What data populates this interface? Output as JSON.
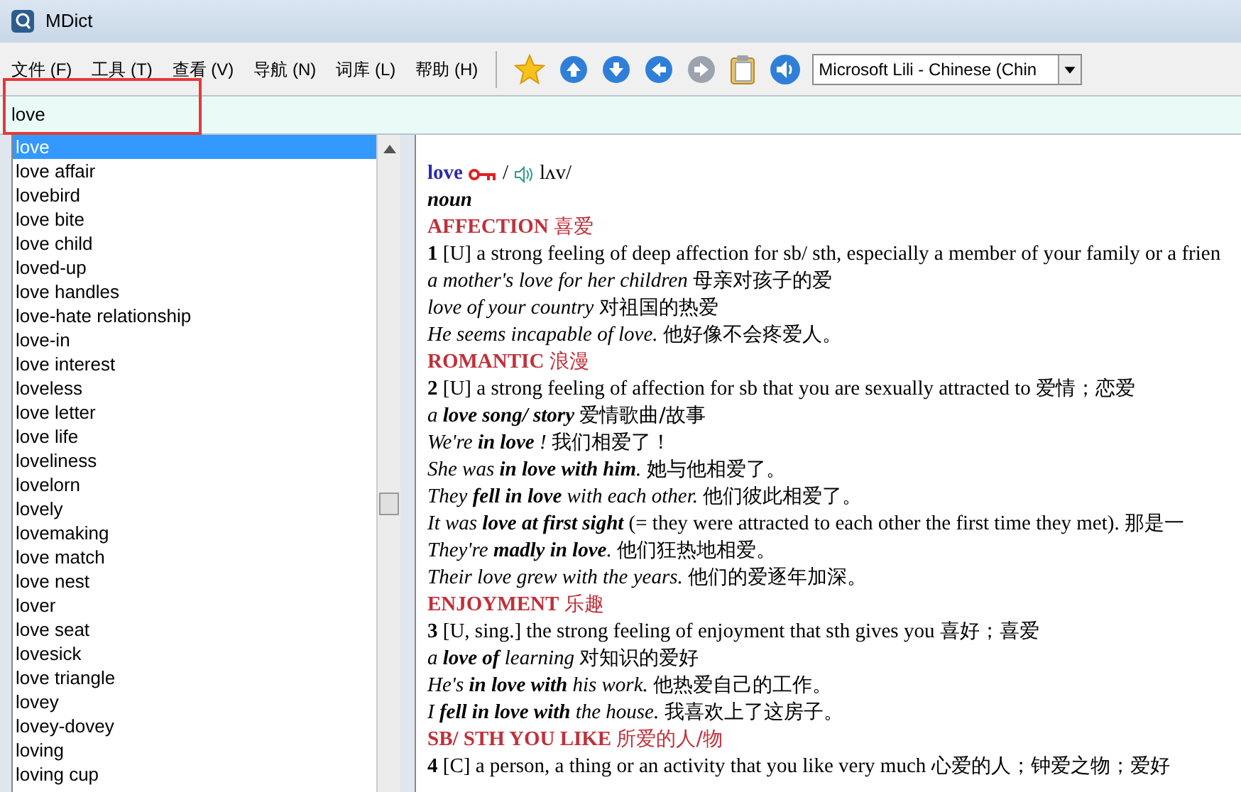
{
  "window": {
    "title": "MDict"
  },
  "menu": [
    {
      "label": "文件 (F)"
    },
    {
      "label": "工具 (T)"
    },
    {
      "label": "查看 (V)"
    },
    {
      "label": "导航 (N)"
    },
    {
      "label": "词库 (L)"
    },
    {
      "label": "帮助 (H)"
    }
  ],
  "toolbar": [
    {
      "kind": "star",
      "disabled": false
    },
    {
      "kind": "up",
      "disabled": false
    },
    {
      "kind": "down",
      "disabled": false
    },
    {
      "kind": "back",
      "disabled": false
    },
    {
      "kind": "forward",
      "disabled": true
    },
    {
      "kind": "clipboard",
      "disabled": false
    },
    {
      "kind": "speaker",
      "disabled": false
    }
  ],
  "voice_select": {
    "value": "Microsoft Lili - Chinese (Chin"
  },
  "search": {
    "value": "love"
  },
  "word_list": [
    {
      "label": "love",
      "selected": true
    },
    {
      "label": "love affair",
      "selected": false
    },
    {
      "label": "lovebird",
      "selected": false
    },
    {
      "label": "love bite",
      "selected": false
    },
    {
      "label": "love child",
      "selected": false
    },
    {
      "label": "loved-up",
      "selected": false
    },
    {
      "label": "love handles",
      "selected": false
    },
    {
      "label": "love-hate relationship",
      "selected": false
    },
    {
      "label": "love-in",
      "selected": false
    },
    {
      "label": "love interest",
      "selected": false
    },
    {
      "label": "loveless",
      "selected": false
    },
    {
      "label": "love letter",
      "selected": false
    },
    {
      "label": "love life",
      "selected": false
    },
    {
      "label": "loveliness",
      "selected": false
    },
    {
      "label": "lovelorn",
      "selected": false
    },
    {
      "label": "lovely",
      "selected": false
    },
    {
      "label": "lovemaking",
      "selected": false
    },
    {
      "label": "love match",
      "selected": false
    },
    {
      "label": "love nest",
      "selected": false
    },
    {
      "label": "lover",
      "selected": false
    },
    {
      "label": "love seat",
      "selected": false
    },
    {
      "label": "lovesick",
      "selected": false
    },
    {
      "label": "love triangle",
      "selected": false
    },
    {
      "label": "lovey",
      "selected": false
    },
    {
      "label": "lovey-dovey",
      "selected": false
    },
    {
      "label": "loving",
      "selected": false
    },
    {
      "label": "loving cup",
      "selected": false
    }
  ],
  "entry": [
    {
      "kind": "headword",
      "word": "love",
      "phonetic": "lʌv/",
      "slash": "/"
    },
    {
      "kind": "pos",
      "text": "noun"
    },
    {
      "kind": "section",
      "title": "AFFECTION",
      "zh": "喜爱"
    },
    {
      "kind": "sense",
      "num": "1",
      "text": "[U] a strong feeling of deep affection for sb/ sth, especially a member of your family or a frien"
    },
    {
      "kind": "example",
      "en": "a mother's love for her children",
      "zh": "母亲对孩子的爱"
    },
    {
      "kind": "example",
      "en": "love of your country",
      "zh": "对祖国的热爱"
    },
    {
      "kind": "example",
      "en": "He seems incapable of love.",
      "zh": "他好像不会疼爱人。"
    },
    {
      "kind": "section",
      "title": "ROMANTIC",
      "zh": "浪漫"
    },
    {
      "kind": "sense",
      "num": "2",
      "text": "[U] a strong feeling of affection for sb that you are sexually attracted to",
      "zh": "爱情；恋爱"
    },
    {
      "kind": "example",
      "en": "a **love song/ story**",
      "zh": "爱情歌曲/故事"
    },
    {
      "kind": "example",
      "en": "We're **in love** !",
      "zh": "我们相爱了！"
    },
    {
      "kind": "example",
      "en": "She was **in love with him**.",
      "zh": "她与他相爱了。"
    },
    {
      "kind": "example",
      "en": "They **fell in love** with each other.",
      "zh": "他们彼此相爱了。"
    },
    {
      "kind": "example",
      "en": "It was **love at first sight**",
      "note": "(= they were attracted to each other the first time they met).",
      "zh": "那是一"
    },
    {
      "kind": "example",
      "en": "They're **madly in love**.",
      "zh": "他们狂热地相爱。"
    },
    {
      "kind": "example",
      "en": "Their love grew with the years.",
      "zh": "他们的爱逐年加深。"
    },
    {
      "kind": "section",
      "title": "ENJOYMENT",
      "zh": "乐趣"
    },
    {
      "kind": "sense",
      "num": "3",
      "text": "[U, sing.] the strong feeling of enjoyment that sth gives you",
      "zh": "喜好；喜爱"
    },
    {
      "kind": "example",
      "en": "a **love of** learning",
      "zh": "对知识的爱好"
    },
    {
      "kind": "example",
      "en": "He's **in love with** his work.",
      "zh": "他热爱自己的工作。"
    },
    {
      "kind": "example",
      "en": "I **fell in love with** the house.",
      "zh": "我喜欢上了这房子。"
    },
    {
      "kind": "section",
      "title": "SB/ STH YOU LIKE",
      "zh": "所爱的人/物"
    },
    {
      "kind": "sense",
      "num": "4",
      "text": "[C] a person, a thing or an activity that you like very much",
      "zh": "心爱的人；钟爱之物；爱好"
    }
  ]
}
